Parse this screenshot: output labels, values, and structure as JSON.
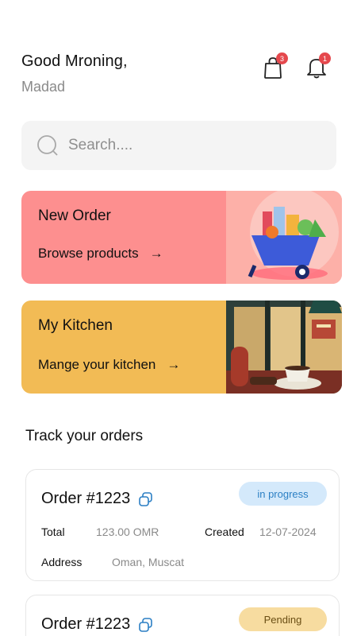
{
  "header": {
    "greeting": "Good Mroning,",
    "username": "Madad",
    "cart_badge": "3",
    "notification_badge": "1"
  },
  "search": {
    "placeholder": "Search...."
  },
  "cards": {
    "new_order": {
      "title": "New Order",
      "link": "Browse products",
      "arrow": "→"
    },
    "kitchen": {
      "title": "My Kitchen",
      "link": "Mange your kitchen",
      "arrow": "→"
    }
  },
  "orders": {
    "title": "Track your orders",
    "items": [
      {
        "number": "Order #1223",
        "status": "in progress",
        "total_label": "Total",
        "total_value": "123.00 OMR",
        "created_label": "Created",
        "created_value": "12-07-2024",
        "address_label": "Address",
        "address_value": "Oman, Muscat"
      },
      {
        "number": "Order #1223",
        "status": "Pending"
      }
    ]
  },
  "colors": {
    "new_order_card": "#fd8f8f",
    "kitchen_card": "#f2bb55",
    "badge": "#e5484d",
    "in_progress_bg": "#d4e9fb",
    "pending_bg": "#f7dca0"
  }
}
